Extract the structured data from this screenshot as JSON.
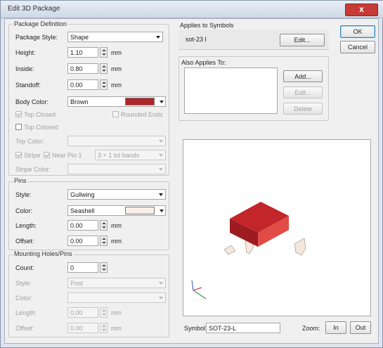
{
  "window": {
    "title": "Edit 3D Package",
    "close_glyph": "x"
  },
  "package_definition": {
    "group_label": "Package Definition",
    "style_label": "Package Style:",
    "style_value": "Shape",
    "height_label": "Height:",
    "height_value": "1.10",
    "height_unit": "mm",
    "inside_label": "Inside:",
    "inside_value": "0.80",
    "inside_unit": "mm",
    "standoff_label": "Standoff:",
    "standoff_value": "0.00",
    "standoff_unit": "mm",
    "body_color_label": "Body Color:",
    "body_color_value": "Brown",
    "body_color_hex": "#b0262a",
    "top_closed_label": "Top Closed",
    "rounded_ends_label": "Rounded Ends",
    "top_colored_label": "Top Colored",
    "top_color_label": "Top Color:",
    "stripe_label": "Stripe",
    "near_pin1_label": "Near Pin 1",
    "bands_value": "3 + 1 tol bands",
    "stripe_color_label": "Stripe Color:"
  },
  "pins": {
    "group_label": "Pins",
    "style_label": "Style:",
    "style_value": "Gullwing",
    "color_label": "Color:",
    "color_value": "Seashell",
    "color_hex": "#fbeee6",
    "length_label": "Length:",
    "length_value": "0.00",
    "length_unit": "mm",
    "offset_label": "Offset:",
    "offset_value": "0.00",
    "offset_unit": "mm"
  },
  "mounting": {
    "group_label": "Mounting Holes/Pins",
    "count_label": "Count:",
    "count_value": "0",
    "style_label": "Style:",
    "style_value": "Post",
    "color_label": "Color:",
    "length_label": "Length:",
    "length_value": "0.00",
    "length_unit": "mm",
    "offset_label": "Offset:",
    "offset_value": "0.00",
    "offset_unit": "mm"
  },
  "applies_to": {
    "label": "Applies to Symbols",
    "value": "sot-23 l",
    "edit_button": "Edit...",
    "also_label": "Also Applies To:",
    "add_button": "Add...",
    "edit2_button": "Edit...",
    "delete_button": "Delete"
  },
  "dialog_buttons": {
    "ok": "OK",
    "cancel": "Cancel"
  },
  "preview": {
    "symbol_label": "Symbol:",
    "symbol_value": "SOT-23-L",
    "zoom_label": "Zoom:",
    "zoom_in": "In",
    "zoom_out": "Out"
  },
  "colors": {
    "accent_red": "#b0262a",
    "window_bg": "#f0f0f0"
  },
  "icons": {
    "close": "close-icon",
    "dropdown": "chevron-down-icon",
    "spinner": "spinner-icon"
  }
}
